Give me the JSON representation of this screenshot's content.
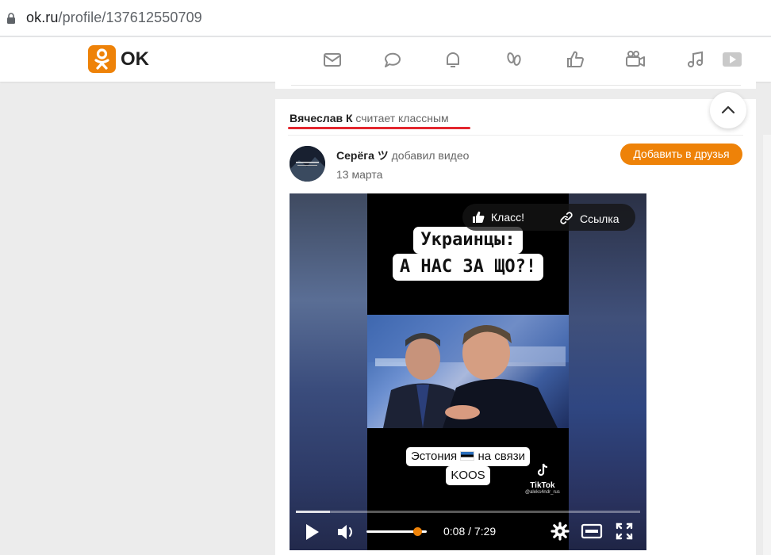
{
  "browser": {
    "url_host": "ok.ru",
    "url_path": "/profile/137612550709"
  },
  "header": {
    "logo_text": "OK",
    "brand_color": "#ee8208",
    "nav_icons": [
      "messages-icon",
      "discussions-icon",
      "notifications-icon",
      "guests-icon",
      "marks-icon",
      "video-icon",
      "music-icon",
      "video-player-icon"
    ]
  },
  "feed_item": {
    "liker_name": "Вячеслав К",
    "liker_action": "считает классным",
    "author_name": "Серёга ツ",
    "author_action": "добавил видео",
    "date": "13 марта",
    "add_friend_label": "Добавить в друзья"
  },
  "video": {
    "title_line1": "Украинцы:",
    "title_line2": "А НАС ЗА ЩО?!",
    "caption_line1": "Эстония",
    "caption_line1b": "на связи",
    "caption_line2": "KOOS",
    "tiktok_label": "TikTok",
    "tiktok_handle": "@aleks4ndr_rus",
    "klass_label": "Класс!",
    "link_label": "Ссылка",
    "time_display": "0:08 / 7:29",
    "buffered_fraction": 0.1,
    "volume_fraction": 0.85
  }
}
